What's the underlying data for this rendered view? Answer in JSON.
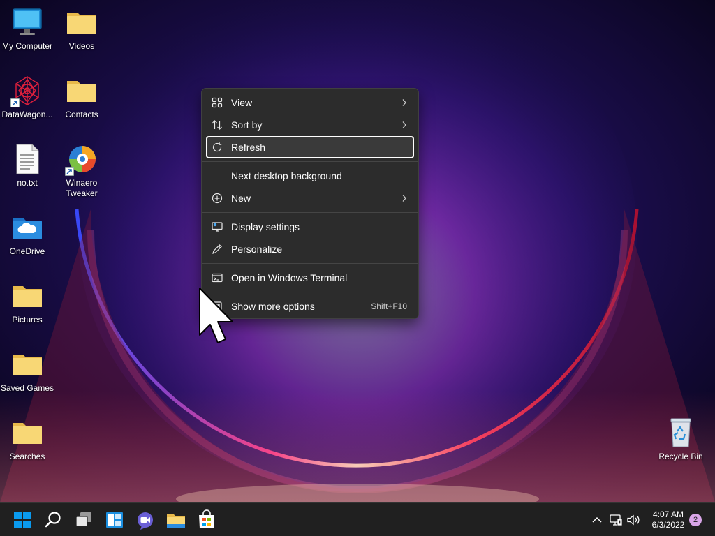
{
  "desktop": {
    "icons": [
      {
        "label": "My Computer",
        "icon": "computer-icon"
      },
      {
        "label": "Videos",
        "icon": "folder-icon"
      },
      {
        "label": "DataWagon...",
        "icon": "datawagon-icon"
      },
      {
        "label": "Contacts",
        "icon": "folder-icon"
      },
      {
        "label": "no.txt",
        "icon": "text-file-icon"
      },
      {
        "label": "Winaero Tweaker",
        "icon": "winaero-icon"
      },
      {
        "label": "OneDrive",
        "icon": "onedrive-folder-icon"
      },
      {
        "label": "Pictures",
        "icon": "folder-icon"
      },
      {
        "label": "Saved Games",
        "icon": "folder-icon"
      },
      {
        "label": "Searches",
        "icon": "folder-icon"
      },
      {
        "label": "Recycle Bin",
        "icon": "recycle-bin-icon"
      }
    ]
  },
  "context_menu": {
    "items": [
      {
        "label": "View",
        "icon": "view-grid-icon",
        "has_submenu": true
      },
      {
        "label": "Sort by",
        "icon": "sort-icon",
        "has_submenu": true
      },
      {
        "label": "Refresh",
        "icon": "refresh-icon",
        "focused": true
      },
      {
        "label": "Next desktop background"
      },
      {
        "label": "New",
        "icon": "new-plus-icon",
        "has_submenu": true
      },
      {
        "label": "Display settings",
        "icon": "display-settings-icon"
      },
      {
        "label": "Personalize",
        "icon": "personalize-pen-icon"
      },
      {
        "label": "Open in Windows Terminal",
        "icon": "terminal-icon"
      },
      {
        "label": "Show more options",
        "icon": "show-more-icon",
        "shortcut": "Shift+F10"
      }
    ]
  },
  "taskbar": {
    "buttons": [
      "start-button",
      "search-button",
      "task-view-button",
      "widgets-button",
      "chat-button",
      "file-explorer-button",
      "store-button"
    ],
    "tray": [
      "show-hidden-icons-chevron",
      "network-icon",
      "volume-icon"
    ],
    "time": "4:07 AM",
    "date": "6/3/2022",
    "notification_count": "2"
  },
  "colors": {
    "menu_bg": "#2c2c2c",
    "taskbar_bg": "#202020",
    "folder_yellow": "#f8d775",
    "accent_blue": "#0078d4"
  }
}
